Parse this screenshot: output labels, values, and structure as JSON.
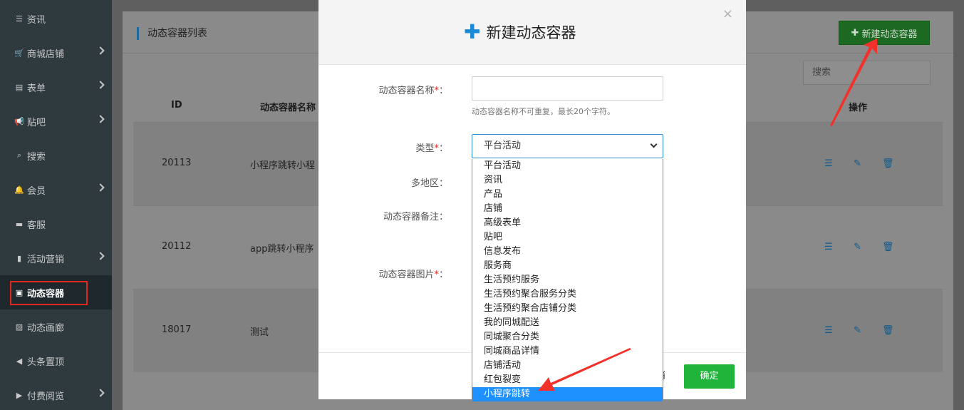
{
  "sidebar": {
    "items": [
      {
        "label": "资讯",
        "icon": "list-icon",
        "chevron": false
      },
      {
        "label": "商城店铺",
        "icon": "cart-icon",
        "chevron": true
      },
      {
        "label": "表单",
        "icon": "form-icon",
        "chevron": true
      },
      {
        "label": "贴吧",
        "icon": "megaphone-icon",
        "chevron": true
      },
      {
        "label": "搜索",
        "icon": "search-icon",
        "chevron": false
      },
      {
        "label": "会员",
        "icon": "bell-icon",
        "chevron": true
      },
      {
        "label": "客服",
        "icon": "chat-icon",
        "chevron": false
      },
      {
        "label": "活动营销",
        "icon": "bookmark-icon",
        "chevron": true
      },
      {
        "label": "动态容器",
        "icon": "inbox-icon",
        "chevron": false
      },
      {
        "label": "动态画廊",
        "icon": "image-icon",
        "chevron": false
      },
      {
        "label": "头条置顶",
        "icon": "volume-icon",
        "chevron": false
      },
      {
        "label": "付费阅览",
        "icon": "play-circle-icon",
        "chevron": true
      }
    ],
    "active_index": 8
  },
  "panel": {
    "title": "动态容器列表",
    "new_button": "新建动态容器",
    "search_placeholder": "搜索",
    "columns": {
      "id": "ID",
      "name": "动态容器名称",
      "actions": "操作"
    },
    "rows": [
      {
        "id": "20113",
        "name": "小程序跳转小程"
      },
      {
        "id": "20112",
        "name": "app跳转小程序"
      },
      {
        "id": "18017",
        "name": "测试"
      }
    ]
  },
  "modal": {
    "title": "新建动态容器",
    "close": "×",
    "fields": {
      "name_label": "动态容器名称",
      "name_hint": "动态容器名称不可重复，最长20个字符。",
      "type_label": "类型",
      "region_label": "多地区",
      "remark_label": "动态容器备注",
      "image_label": "动态容器图片",
      "required_mark": "*",
      "colon": "："
    },
    "type_selected": "平台活动",
    "type_options": [
      "平台活动",
      "资讯",
      "产品",
      "店铺",
      "高级表单",
      "贴吧",
      "信息发布",
      "服务商",
      "生活预约服务",
      "生活预约聚合服务分类",
      "生活预约聚合店铺分类",
      "我的同城配送",
      "同城聚合分类",
      "同城商品详情",
      "店铺活动",
      "红包裂变",
      "小程序跳转"
    ],
    "highlighted_option": "小程序跳转",
    "cancel_label": "消",
    "ok_label": "确定"
  },
  "colors": {
    "sidebar_bg": "#2f3a3f",
    "accent_blue": "#1e90ff",
    "ok_green": "#20b53a",
    "annotation_red": "#e0281e"
  }
}
